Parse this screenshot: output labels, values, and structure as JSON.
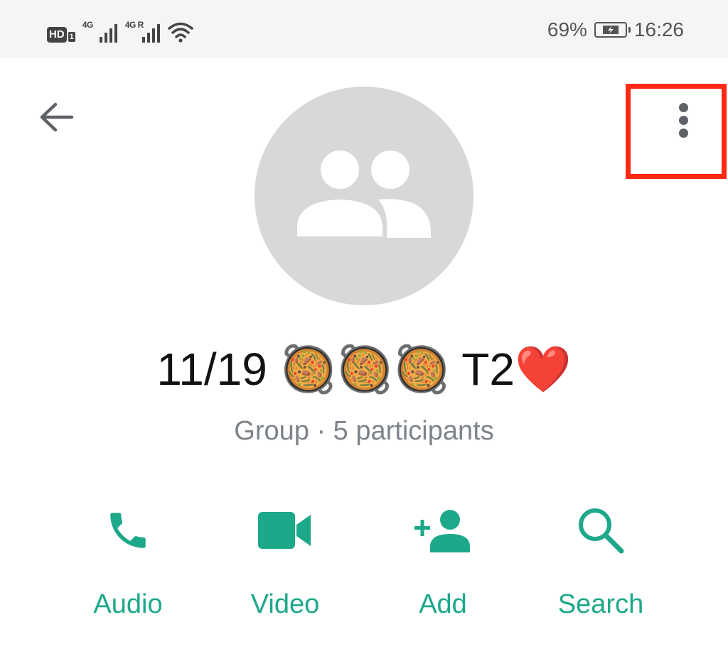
{
  "status_bar": {
    "hd_label": "HD",
    "sim_number": "1",
    "signal1_network": "4G",
    "signal2_network": "4G R",
    "battery_percent": "69%",
    "time": "16:26"
  },
  "header": {
    "back_icon": "arrow-back-icon",
    "menu_icon": "more-vertical-icon"
  },
  "group": {
    "name": "11/19 🥘🥘🥘   T2❤️",
    "subtitle": "Group · 5 participants",
    "avatar_icon": "group-avatar-icon"
  },
  "actions": [
    {
      "label": "Audio",
      "icon": "phone-icon"
    },
    {
      "label": "Video",
      "icon": "videocam-icon"
    },
    {
      "label": "Add",
      "icon": "person-add-icon"
    },
    {
      "label": "Search",
      "icon": "search-icon"
    }
  ],
  "colors": {
    "accent": "#1da88a",
    "highlight": "#ff2a14",
    "avatar_bg": "#d6d8da"
  }
}
